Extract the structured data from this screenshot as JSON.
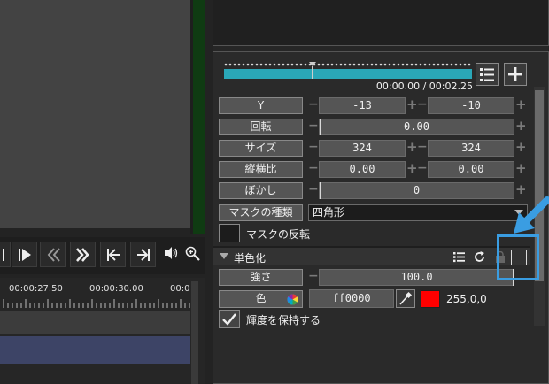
{
  "transport": {
    "icons": [
      "step-back-partial-icon",
      "step-forward-icon",
      "rewind-icon",
      "fast-forward-icon",
      "jump-start-icon",
      "jump-end-icon",
      "volume-icon",
      "zoom-icon"
    ]
  },
  "timeline": {
    "timecodes": [
      "00:00:27.50",
      "00:00:30.00",
      "00:0"
    ]
  },
  "keyframes": {
    "time": "00:00.00 / 00:02.25"
  },
  "rows": {
    "y": {
      "label": "Y",
      "value1": "-13",
      "value2": "-10"
    },
    "rotation": {
      "label": "回転",
      "value": "0.00"
    },
    "size": {
      "label": "サイズ",
      "value1": "324",
      "value2": "324"
    },
    "aspect": {
      "label": "縦横比",
      "value1": "0.00",
      "value2": "0.00"
    },
    "blur": {
      "label": "ぼかし",
      "value": "0"
    },
    "mask_type": {
      "label": "マスクの種類",
      "value": "四角形"
    },
    "mask_invert": {
      "label": "マスクの反転"
    }
  },
  "section": {
    "title": "単色化",
    "strength": {
      "label": "強さ",
      "value": "100.0"
    },
    "color": {
      "label": "色",
      "hex": "ff0000",
      "rgb": "255,0,0",
      "swatch": "#ff0000"
    },
    "keep_luminance": {
      "label": "輝度を保持する",
      "checked": true
    }
  },
  "colors": {
    "accent": "#2aa7b7",
    "highlight": "#3a9de2"
  }
}
